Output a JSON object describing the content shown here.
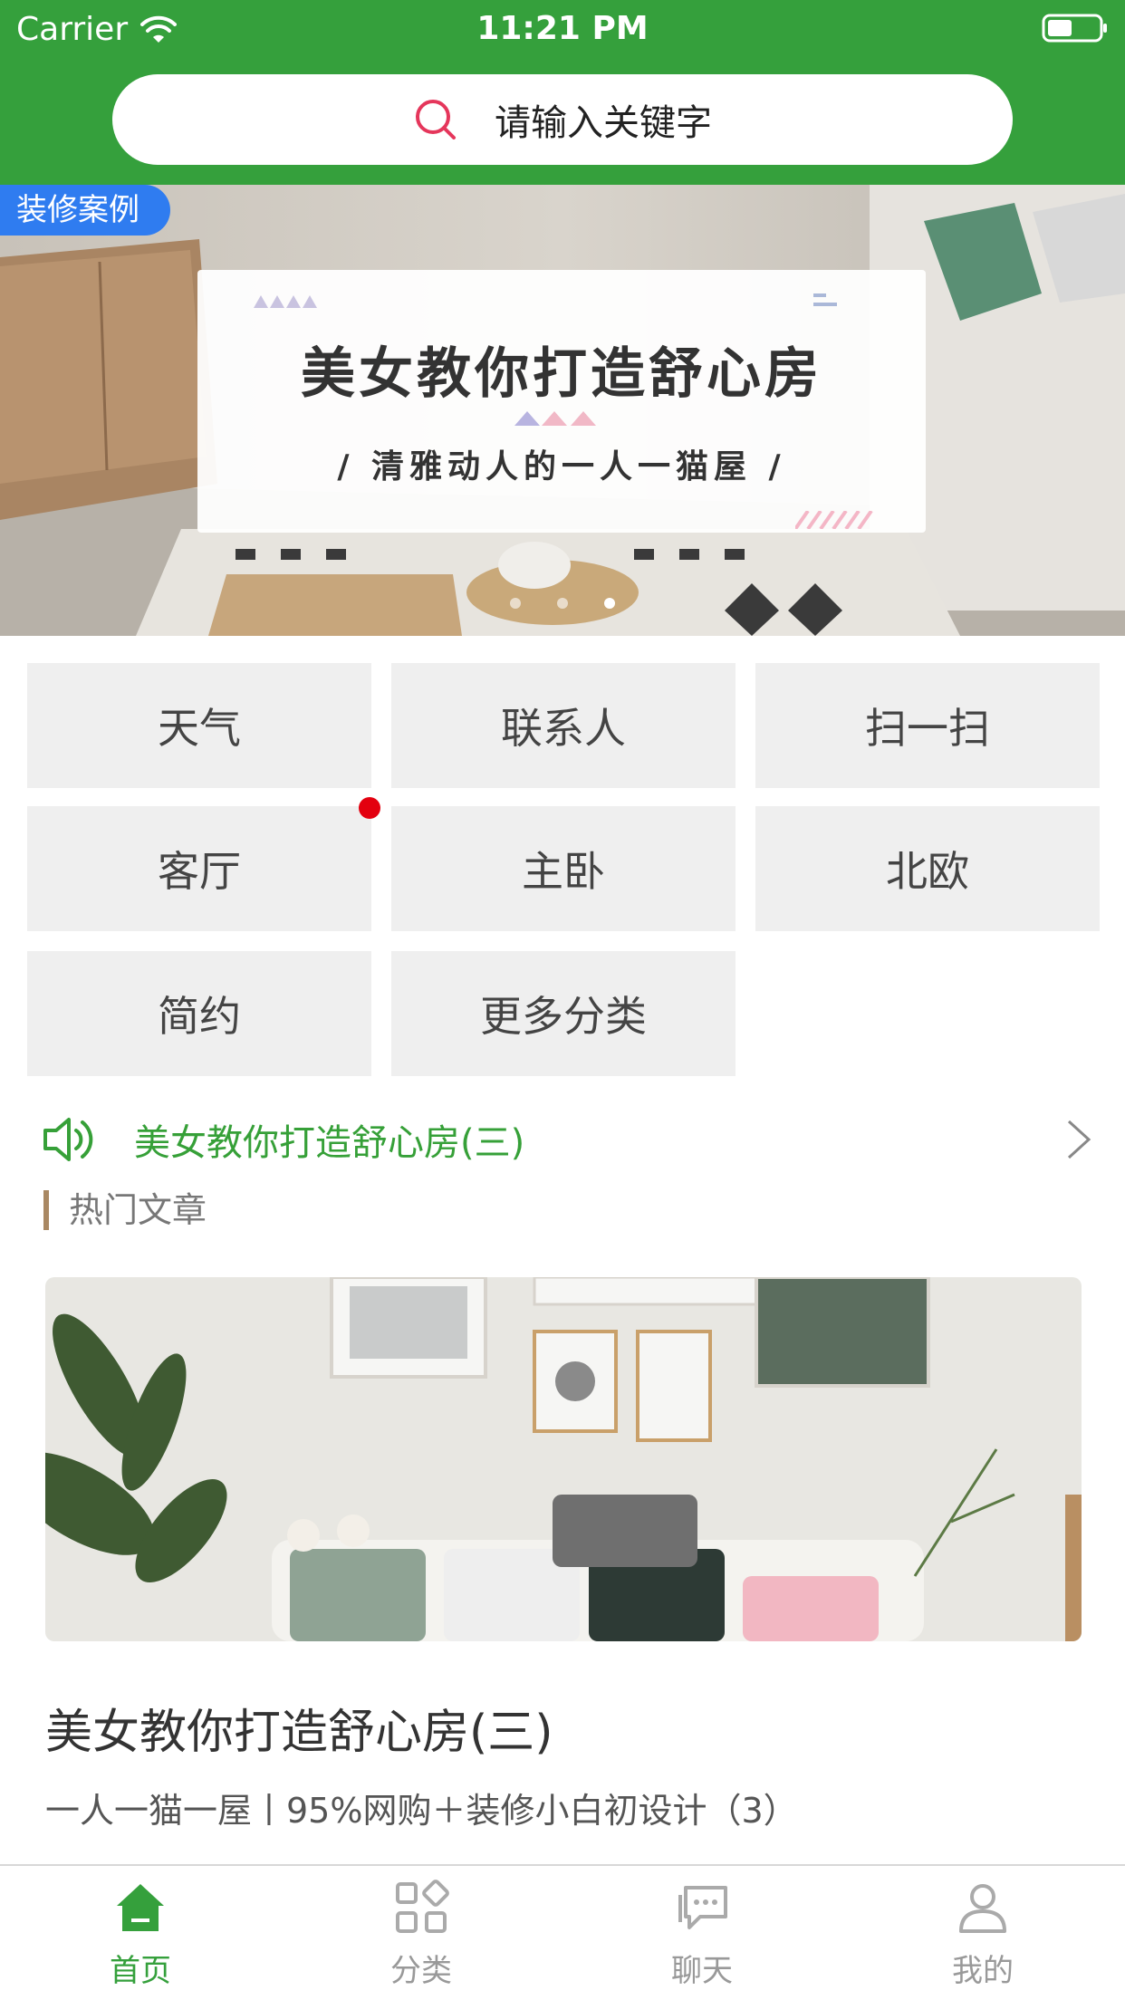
{
  "status_bar": {
    "carrier": "Carrier",
    "time": "11:21 PM"
  },
  "search": {
    "placeholder": "请输入关键字"
  },
  "banner": {
    "tag": "装修案例",
    "title": "美女教你打造舒心房",
    "subtitle": "/ 清雅动人的一人一猫屋 /",
    "slide_count": 3,
    "active_slide": 3
  },
  "grid": {
    "items": [
      {
        "label": "天气"
      },
      {
        "label": "联系人"
      },
      {
        "label": "扫一扫"
      },
      {
        "label": "客厅"
      },
      {
        "label": "主卧"
      },
      {
        "label": "北欧"
      },
      {
        "label": "简约"
      },
      {
        "label": "更多分类"
      }
    ]
  },
  "notice": {
    "text": "美女教你打造舒心房(三)"
  },
  "section": {
    "title": "热门文章"
  },
  "article": {
    "title": "美女教你打造舒心房(三)",
    "subtitle": "一人一猫一屋丨95%网购＋装修小白初设计（3）"
  },
  "tabbar": {
    "items": [
      {
        "label": "首页",
        "icon": "home-icon",
        "active": true
      },
      {
        "label": "分类",
        "icon": "category-icon",
        "active": false
      },
      {
        "label": "聊天",
        "icon": "chat-icon",
        "active": false
      },
      {
        "label": "我的",
        "icon": "profile-icon",
        "active": false
      }
    ]
  },
  "colors": {
    "primary": "#35a03c",
    "tag": "#2f7cf0",
    "badge": "#e3000f",
    "section_bar": "#a98863"
  }
}
